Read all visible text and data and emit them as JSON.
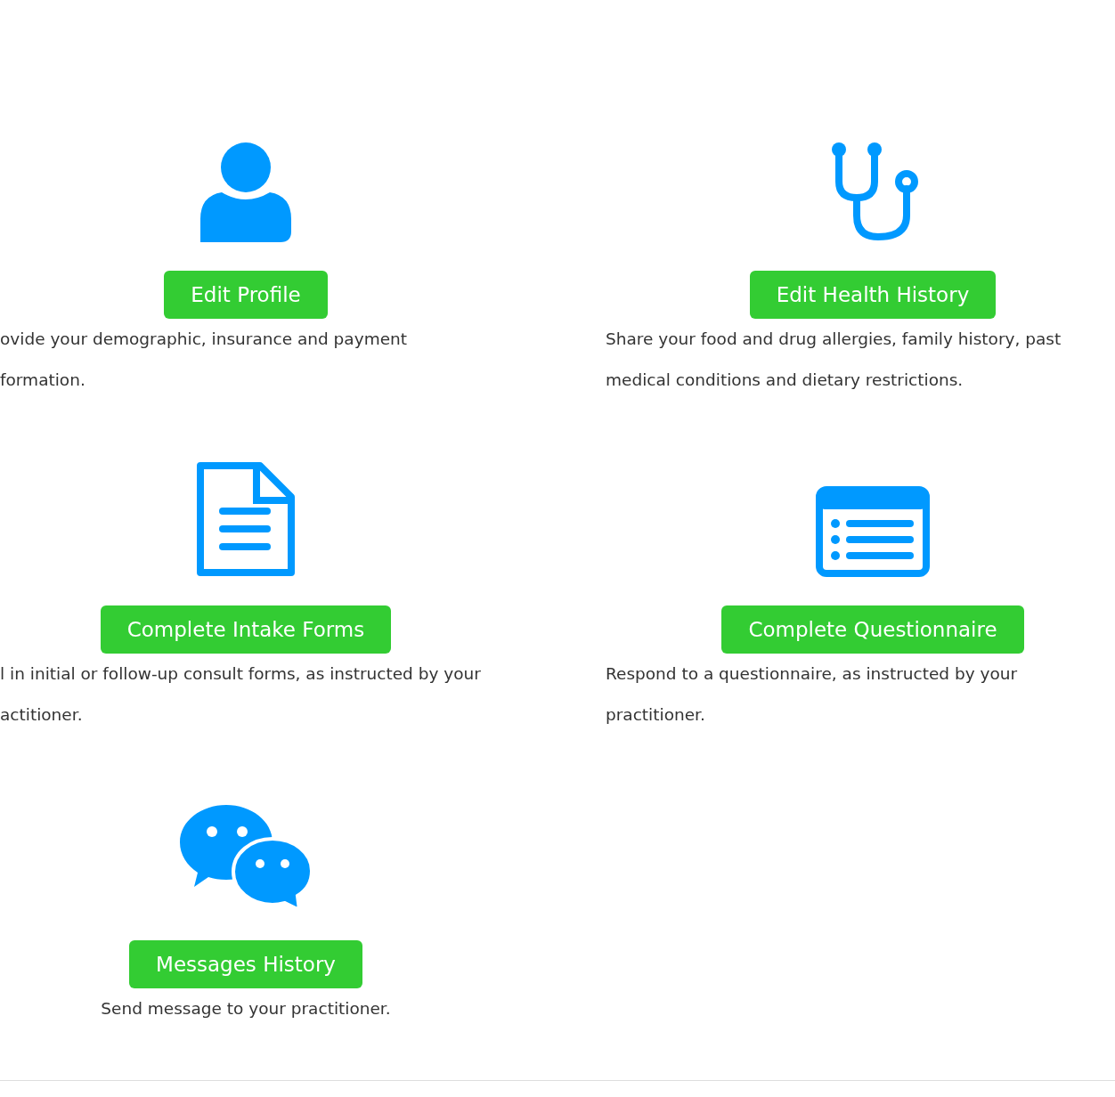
{
  "cards": [
    {
      "button": "Edit Profile",
      "kind": "wrapped",
      "lines": [
        "ovide your demographic, insurance and payment",
        "formation."
      ]
    },
    {
      "button": "Edit Health History",
      "kind": "wrapped",
      "lines": [
        "Share your food and drug allergies, family history, past",
        "medical conditions and dietary restrictions."
      ]
    },
    {
      "button": "Complete Intake Forms",
      "kind": "wrapped",
      "lines": [
        "l in initial or follow-up consult forms, as instructed by your",
        "actitioner."
      ]
    },
    {
      "button": "Complete Questionnaire",
      "kind": "wrapped",
      "lines": [
        "Respond to a questionnaire, as instructed by your",
        "practitioner."
      ]
    },
    {
      "button": "Messages History",
      "kind": "short",
      "lines": [
        "Send message to your practitioner."
      ]
    }
  ]
}
